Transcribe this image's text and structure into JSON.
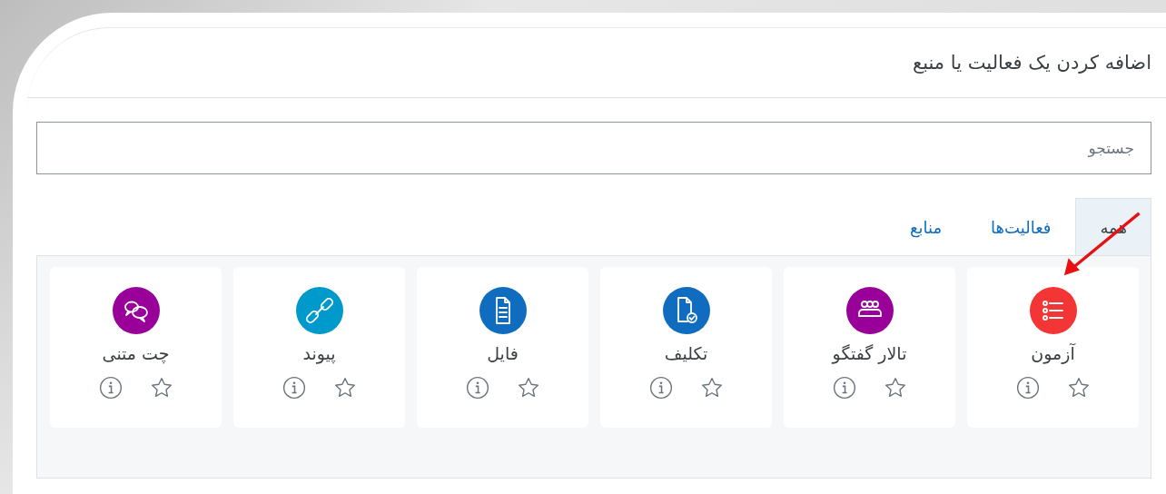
{
  "dialog": {
    "title": "اضافه کردن یک فعالیت یا منبع"
  },
  "search": {
    "placeholder": "جستجو"
  },
  "tabs": [
    {
      "label": "همه",
      "selected": true
    },
    {
      "label": "فعالیت‌ها",
      "selected": false
    },
    {
      "label": "منابع",
      "selected": false
    }
  ],
  "modules": [
    {
      "name": "آزمون",
      "kind": "quiz",
      "color": "#f33535",
      "starred": false
    },
    {
      "name": "تالار گفتگو",
      "kind": "forum",
      "color": "#990099",
      "starred": false
    },
    {
      "name": "تکلیف",
      "kind": "assignment",
      "color": "#0f6cbf",
      "starred": false
    },
    {
      "name": "فایل",
      "kind": "file",
      "color": "#0f6cbf",
      "starred": false
    },
    {
      "name": "پیوند",
      "kind": "link",
      "color": "#0099cc",
      "starred": false
    },
    {
      "name": "چت متنی",
      "kind": "chat",
      "color": "#990099",
      "starred": false
    }
  ]
}
